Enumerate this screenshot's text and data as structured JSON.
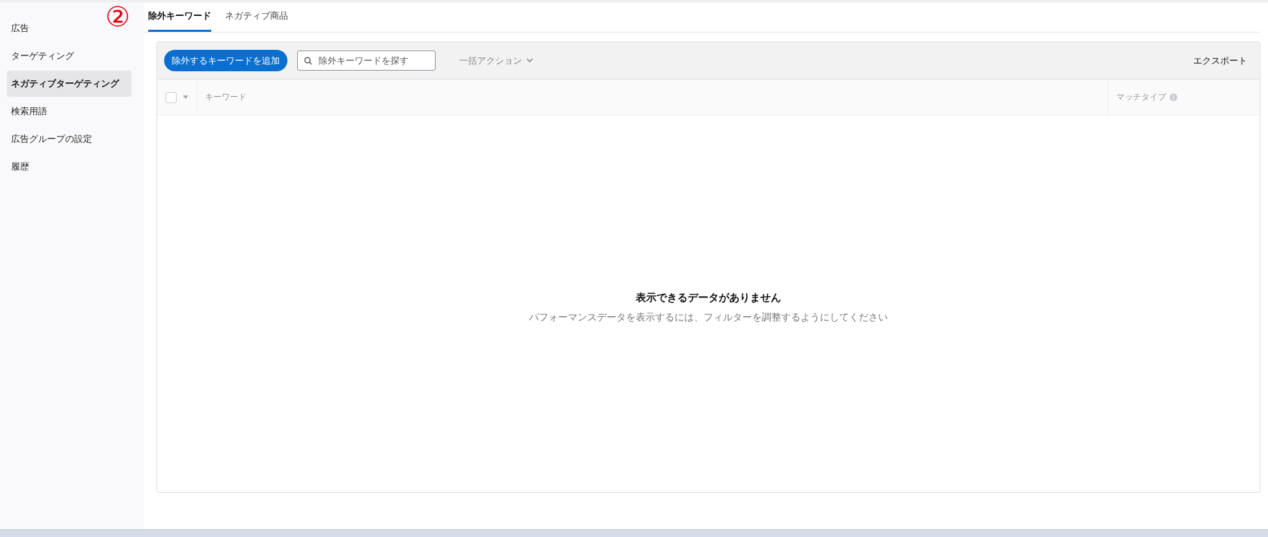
{
  "annotation": {
    "text": "②"
  },
  "sidebar": {
    "items": [
      {
        "label": "広告",
        "selected": false
      },
      {
        "label": "ターゲティング",
        "selected": false
      },
      {
        "label": "ネガティブターゲティング",
        "selected": true
      },
      {
        "label": "検索用語",
        "selected": false
      },
      {
        "label": "広告グループの設定",
        "selected": false
      },
      {
        "label": "履歴",
        "selected": false
      }
    ]
  },
  "tabs": [
    {
      "label": "除外キーワード",
      "selected": true
    },
    {
      "label": "ネガティブ商品",
      "selected": false
    }
  ],
  "toolbar": {
    "add_button": "除外するキーワードを追加",
    "search": {
      "placeholder": "除外キーワードを探す"
    },
    "bulk_actions": "一括アクション",
    "export": "エクスポート"
  },
  "table": {
    "select_all_checked": false,
    "columns": [
      "キーワード",
      "マッチタイプ"
    ]
  },
  "empty_state": {
    "title": "表示できるデータがありません",
    "message": "パフォーマンスデータを表示するには、フィルターを調整するようにしてください"
  }
}
